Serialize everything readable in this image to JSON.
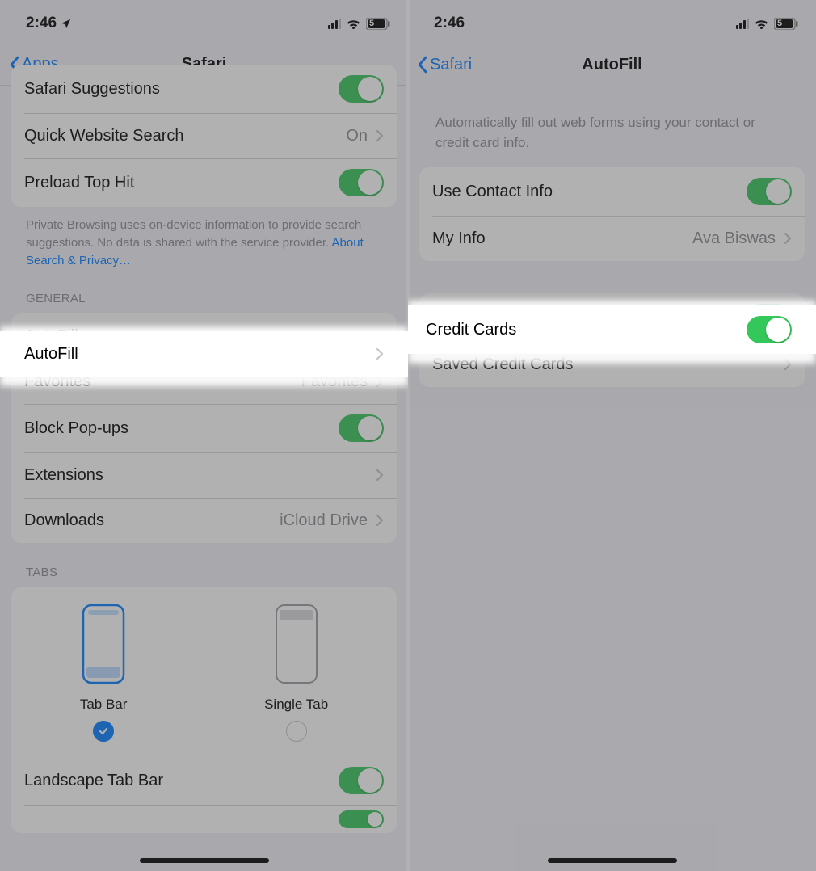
{
  "status": {
    "time": "2:46",
    "battery_label": "5"
  },
  "left": {
    "back_label": "Apps",
    "title": "Safari",
    "top_rows": {
      "suggestions": "Safari Suggestions",
      "quick_search": "Quick Website Search",
      "quick_search_value": "On",
      "preload": "Preload Top Hit"
    },
    "privacy_note": "Private Browsing uses on-device information to provide search suggestions. No data is shared with the service provider. ",
    "privacy_link": "About Search & Privacy…",
    "section_general": "GENERAL",
    "general": {
      "autofill": "AutoFill",
      "favorites": "Favorites",
      "favorites_value": "Favorites",
      "block_popups": "Block Pop-ups",
      "extensions": "Extensions",
      "downloads": "Downloads",
      "downloads_value": "iCloud Drive"
    },
    "section_tabs": "TABS",
    "tabs": {
      "tab_bar": "Tab Bar",
      "single_tab": "Single Tab",
      "landscape": "Landscape Tab Bar"
    }
  },
  "right": {
    "back_label": "Safari",
    "title": "AutoFill",
    "intro": "Automatically fill out web forms using your contact or credit card info.",
    "contact": {
      "use_contact": "Use Contact Info",
      "my_info": "My Info",
      "my_info_value": "Ava Biswas"
    },
    "cards": {
      "credit_cards": "Credit Cards",
      "saved_cards": "Saved Credit Cards"
    }
  }
}
